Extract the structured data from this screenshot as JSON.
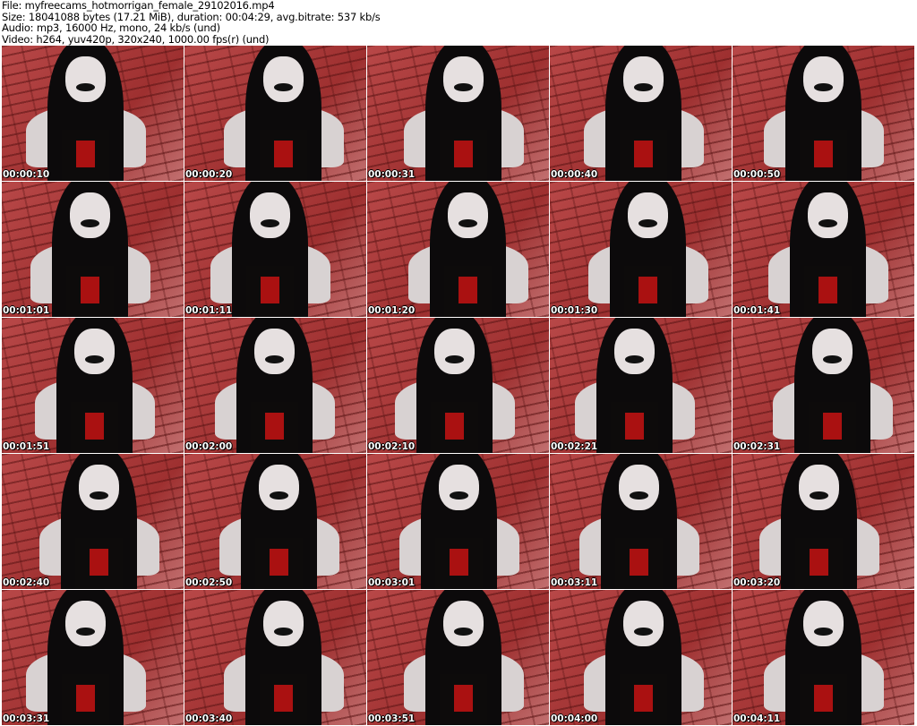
{
  "header": {
    "file": "File: myfreecams_hotmorrigan_female_29102016.mp4",
    "size": "Size: 18041088 bytes (17.21 MiB), duration: 00:04:29, avg.bitrate: 537 kb/s",
    "audio": "Audio: mp3, 16000 Hz, mono, 24 kb/s (und)",
    "video": "Video: h264, yuv420p, 320x240, 1000.00 fps(r) (und)"
  },
  "thumbnails": [
    "00:00:10",
    "00:00:20",
    "00:00:31",
    "00:00:40",
    "00:00:50",
    "00:01:01",
    "00:01:11",
    "00:01:20",
    "00:01:30",
    "00:01:41",
    "00:01:51",
    "00:02:00",
    "00:02:10",
    "00:02:21",
    "00:02:31",
    "00:02:40",
    "00:02:50",
    "00:03:01",
    "00:03:11",
    "00:03:20",
    "00:03:31",
    "00:03:40",
    "00:03:51",
    "00:04:00",
    "00:04:11"
  ]
}
